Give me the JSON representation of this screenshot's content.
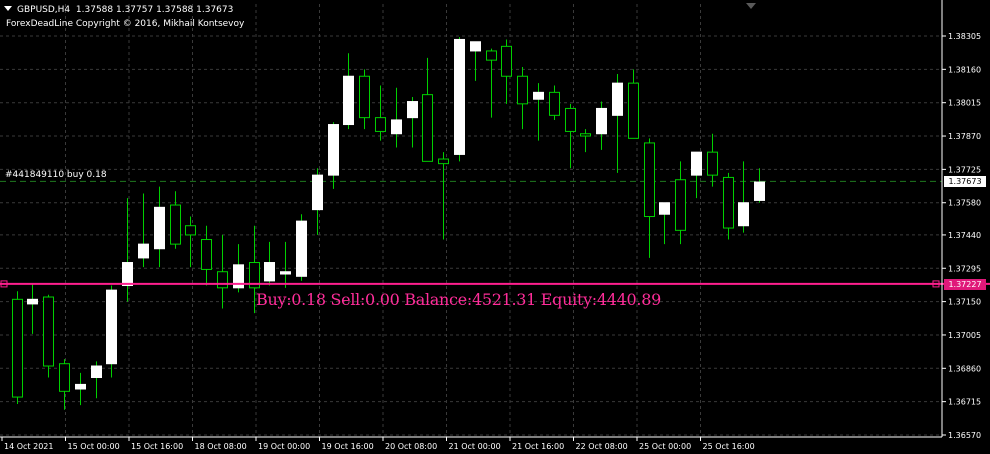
{
  "chart_header": {
    "symbol": "GBPUSD,H4",
    "ohlc": "1.37588 1.37757 1.37588 1.37673",
    "indicator_copyright": "ForexDeadLine Copyright © 2016, Mikhail Kontsevoy"
  },
  "order_line": {
    "label": "#441849110 buy 0.18",
    "price": 1.37673
  },
  "level_line": {
    "price_label": "1.37227",
    "price": 1.37227
  },
  "status_text": "Buy:0.18 Sell:0.00 Balance:4521.31 Equity:4440.89",
  "colors": {
    "background": "#000000",
    "grid": "#3a3a3a",
    "bull_body": "#ffffff",
    "bear_body": "#000000",
    "wick": "#00d000",
    "level_line": "#ff1f8f",
    "status_text": "#ff2d9a",
    "order_line": "#1f7a1f"
  },
  "chart_data": {
    "type": "candlestick",
    "title": "GBPUSD,H4",
    "price_axis": {
      "ticks": [
        1.38305,
        1.3816,
        1.38015,
        1.3787,
        1.37725,
        1.3758,
        1.3744,
        1.37295,
        1.3715,
        1.37005,
        1.3686,
        1.36715,
        1.3657
      ],
      "current_price": 1.37673
    },
    "time_axis": {
      "labels": [
        "14 Oct 2021",
        "15 Oct 00:00",
        "15 Oct 16:00",
        "18 Oct 08:00",
        "19 Oct 00:00",
        "19 Oct 16:00",
        "20 Oct 08:00",
        "21 Oct 00:00",
        "21 Oct 16:00",
        "22 Oct 08:00",
        "25 Oct 00:00",
        "25 Oct 16:00"
      ]
    },
    "candles": [
      {
        "o": 1.3716,
        "h": 1.37195,
        "l": 1.36705,
        "c": 1.36735
      },
      {
        "o": 1.3714,
        "h": 1.3723,
        "l": 1.3701,
        "c": 1.3716
      },
      {
        "o": 1.3717,
        "h": 1.3718,
        "l": 1.3682,
        "c": 1.3687
      },
      {
        "o": 1.3688,
        "h": 1.369,
        "l": 1.3668,
        "c": 1.3676
      },
      {
        "o": 1.3677,
        "h": 1.3684,
        "l": 1.367,
        "c": 1.3679
      },
      {
        "o": 1.3682,
        "h": 1.3689,
        "l": 1.3673,
        "c": 1.3687
      },
      {
        "o": 1.3688,
        "h": 1.3722,
        "l": 1.3682,
        "c": 1.372
      },
      {
        "o": 1.3722,
        "h": 1.376,
        "l": 1.3715,
        "c": 1.3732
      },
      {
        "o": 1.3734,
        "h": 1.3762,
        "l": 1.373,
        "c": 1.374
      },
      {
        "o": 1.3738,
        "h": 1.3765,
        "l": 1.373,
        "c": 1.3756
      },
      {
        "o": 1.3757,
        "h": 1.3763,
        "l": 1.3738,
        "c": 1.374
      },
      {
        "o": 1.3748,
        "h": 1.3752,
        "l": 1.373,
        "c": 1.3744
      },
      {
        "o": 1.3742,
        "h": 1.3748,
        "l": 1.3722,
        "c": 1.3729
      },
      {
        "o": 1.3728,
        "h": 1.3744,
        "l": 1.3712,
        "c": 1.3721
      },
      {
        "o": 1.3721,
        "h": 1.374,
        "l": 1.3719,
        "c": 1.3731
      },
      {
        "o": 1.3732,
        "h": 1.3748,
        "l": 1.371,
        "c": 1.3721
      },
      {
        "o": 1.3724,
        "h": 1.3741,
        "l": 1.3722,
        "c": 1.3732
      },
      {
        "o": 1.3727,
        "h": 1.3741,
        "l": 1.3721,
        "c": 1.3728
      },
      {
        "o": 1.3726,
        "h": 1.3753,
        "l": 1.3724,
        "c": 1.375
      },
      {
        "o": 1.3755,
        "h": 1.3773,
        "l": 1.3744,
        "c": 1.377
      },
      {
        "o": 1.377,
        "h": 1.3793,
        "l": 1.3764,
        "c": 1.3792
      },
      {
        "o": 1.3792,
        "h": 1.3823,
        "l": 1.379,
        "c": 1.3813
      },
      {
        "o": 1.3813,
        "h": 1.3816,
        "l": 1.379,
        "c": 1.3795
      },
      {
        "o": 1.3795,
        "h": 1.3809,
        "l": 1.3785,
        "c": 1.3789
      },
      {
        "o": 1.3788,
        "h": 1.3808,
        "l": 1.3782,
        "c": 1.3794
      },
      {
        "o": 1.3795,
        "h": 1.3804,
        "l": 1.3782,
        "c": 1.3802
      },
      {
        "o": 1.3805,
        "h": 1.3821,
        "l": 1.3776,
        "c": 1.3776
      },
      {
        "o": 1.3777,
        "h": 1.378,
        "l": 1.3742,
        "c": 1.3775
      },
      {
        "o": 1.3779,
        "h": 1.383,
        "l": 1.3776,
        "c": 1.3829
      },
      {
        "o": 1.3824,
        "h": 1.3828,
        "l": 1.3811,
        "c": 1.3828
      },
      {
        "o": 1.3824,
        "h": 1.3825,
        "l": 1.3795,
        "c": 1.382
      },
      {
        "o": 1.3826,
        "h": 1.3829,
        "l": 1.3801,
        "c": 1.3813
      },
      {
        "o": 1.3813,
        "h": 1.3817,
        "l": 1.379,
        "c": 1.3801
      },
      {
        "o": 1.3803,
        "h": 1.381,
        "l": 1.3785,
        "c": 1.3806
      },
      {
        "o": 1.3806,
        "h": 1.3809,
        "l": 1.3794,
        "c": 1.3796
      },
      {
        "o": 1.3799,
        "h": 1.3801,
        "l": 1.3773,
        "c": 1.3789
      },
      {
        "o": 1.3788,
        "h": 1.379,
        "l": 1.378,
        "c": 1.3787
      },
      {
        "o": 1.3788,
        "h": 1.3802,
        "l": 1.3781,
        "c": 1.3799
      },
      {
        "o": 1.3796,
        "h": 1.3814,
        "l": 1.3771,
        "c": 1.381
      },
      {
        "o": 1.381,
        "h": 1.3816,
        "l": 1.3786,
        "c": 1.3786
      },
      {
        "o": 1.3784,
        "h": 1.3786,
        "l": 1.3734,
        "c": 1.3752
      },
      {
        "o": 1.3753,
        "h": 1.3758,
        "l": 1.374,
        "c": 1.3758
      },
      {
        "o": 1.3768,
        "h": 1.3776,
        "l": 1.374,
        "c": 1.3746
      },
      {
        "o": 1.377,
        "h": 1.378,
        "l": 1.376,
        "c": 1.378
      },
      {
        "o": 1.378,
        "h": 1.3788,
        "l": 1.3765,
        "c": 1.377
      },
      {
        "o": 1.3769,
        "h": 1.3771,
        "l": 1.3742,
        "c": 1.3747
      },
      {
        "o": 1.3748,
        "h": 1.3776,
        "l": 1.3745,
        "c": 1.3758
      },
      {
        "o": 1.3759,
        "h": 1.3773,
        "l": 1.3758,
        "c": 1.3767
      }
    ]
  }
}
